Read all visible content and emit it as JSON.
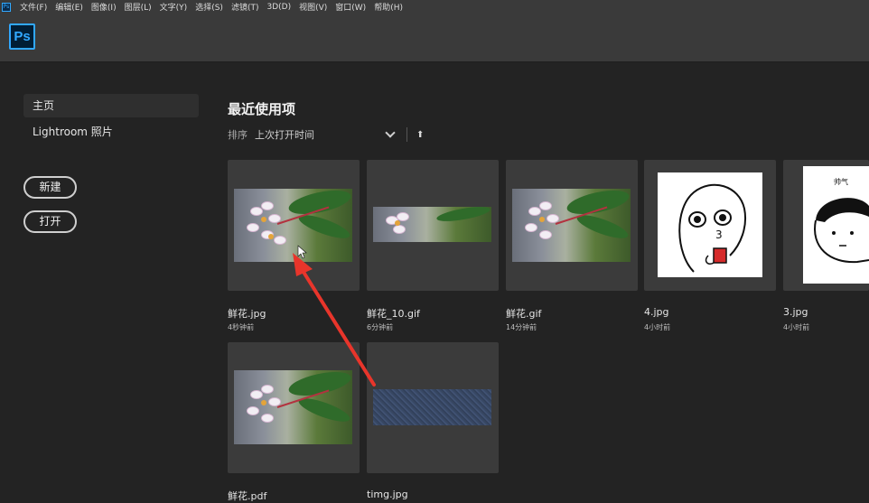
{
  "menubar": {
    "app_icon": "Ps",
    "items": [
      "文件(F)",
      "编辑(E)",
      "图像(I)",
      "图层(L)",
      "文字(Y)",
      "选择(S)",
      "滤镜(T)",
      "3D(D)",
      "视图(V)",
      "窗口(W)",
      "帮助(H)"
    ]
  },
  "header": {
    "logo_text": "Ps"
  },
  "sidebar": {
    "nav": [
      {
        "label": "主页",
        "active": true
      },
      {
        "label": "Lightroom 照片",
        "active": false
      }
    ],
    "new_button": "新建",
    "open_button": "打开"
  },
  "main": {
    "title": "最近使用项",
    "sort_label": "排序",
    "sort_value": "上次打开时间",
    "sort_direction_icon": "arrow-up-icon"
  },
  "files": [
    {
      "name": "鲜花.jpg",
      "time": "4秒钟前",
      "thumb": "flower"
    },
    {
      "name": "鲜花_10.gif",
      "time": "6分钟前",
      "thumb": "flower-wide"
    },
    {
      "name": "鲜花.gif",
      "time": "14分钟前",
      "thumb": "flower"
    },
    {
      "name": "4.jpg",
      "time": "4小时前",
      "thumb": "cartoon-3"
    },
    {
      "name": "3.jpg",
      "time": "4小时前",
      "thumb": "cartoon-face"
    },
    {
      "name": "鲜花.pdf",
      "time": "",
      "thumb": "flower"
    },
    {
      "name": "timg.jpg",
      "time": "",
      "thumb": "blue-texture"
    }
  ],
  "thumb_texts": {
    "cartoon_number": "3",
    "cartoon_caption": "帅气"
  },
  "colors": {
    "accent": "#31a8ff",
    "annotation_arrow": "#e8352b"
  }
}
